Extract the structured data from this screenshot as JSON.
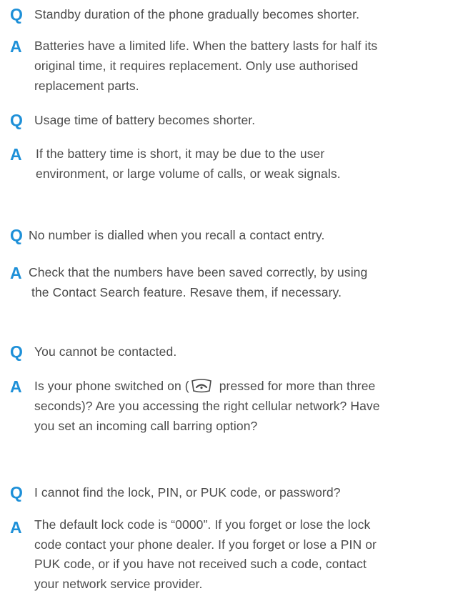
{
  "markers": {
    "question": "Q",
    "answer": "A"
  },
  "items": [
    {
      "question": [
        "Standby duration of the phone gradually becomes shorter."
      ],
      "answer": [
        "Batteries have a limited life. When the battery lasts for half its",
        "original time, it requires replacement. Only use authorised",
        "replacement parts."
      ]
    },
    {
      "question": [
        "Usage time of battery becomes shorter."
      ],
      "answer": [
        "If the battery time is short, it may be due to the user",
        "environment, or large volume of calls, or weak signals."
      ]
    },
    {
      "question": [
        "No number is dialled when you recall a contact entry."
      ],
      "answer": [
        "Check that the numbers have been saved correctly, by using",
        "the Contact Search feature. Resave them, if necessary."
      ]
    },
    {
      "question": [
        "You cannot be contacted."
      ],
      "answer_first_before_icon": "Is your phone switched on (",
      "answer_first_after_icon": "pressed for more than three",
      "answer_icon": "end-key-icon",
      "answer": [
        "seconds)? Are you accessing the right cellular network? Have",
        "you set an incoming call barring option?"
      ]
    },
    {
      "question": [
        "I cannot find the lock, PIN, or PUK code, or password?"
      ],
      "answer": [
        "The default lock code is “0000”. If you forget or lose the lock",
        "code contact your phone dealer. If you forget or lose a PIN or",
        "PUK code, or if you have not received such a code, contact",
        "your network service provider."
      ]
    }
  ],
  "colors": {
    "marker": "#1e90d8",
    "text": "#4a4a4a"
  }
}
